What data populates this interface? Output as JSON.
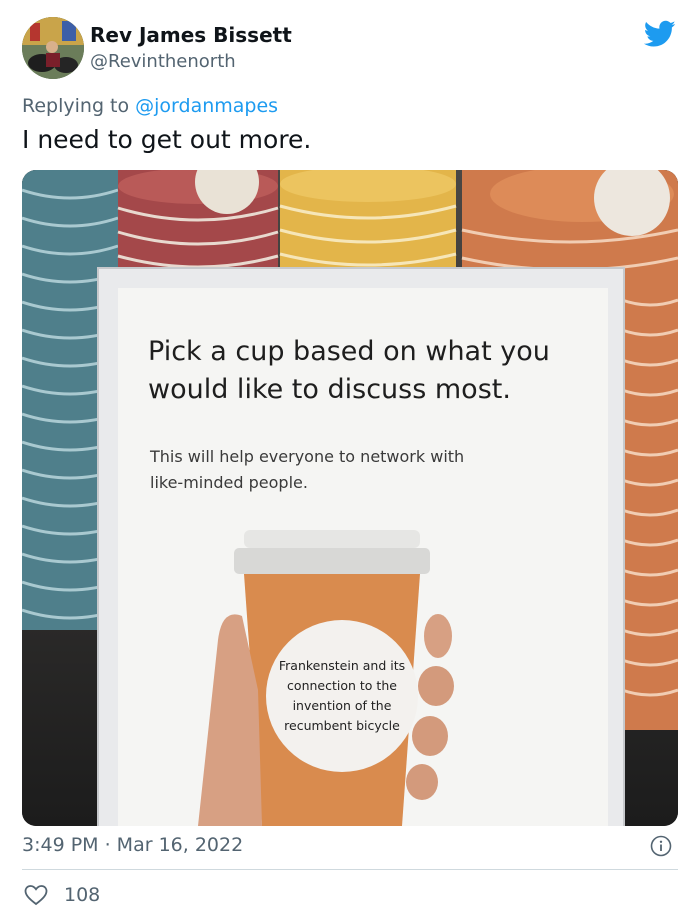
{
  "author": {
    "name": "Rev James Bissett",
    "handle": "@Revinthenorth"
  },
  "reply": {
    "prefix": "Replying to ",
    "to": "@jordanmapes"
  },
  "tweet_text": "I need to get out more.",
  "photo": {
    "sign_heading_line1": "Pick a cup based on what you",
    "sign_heading_line2": "would like to discuss most.",
    "sign_sub_line1": "This will help everyone to network with",
    "sign_sub_line2": "like-minded people.",
    "cup_label_line1": "Frankenstein and its",
    "cup_label_line2": "connection to the",
    "cup_label_line3": "invention of the",
    "cup_label_line4": "recumbent bicycle"
  },
  "timestamp": "3:49 PM · Mar 16, 2022",
  "likes": "108",
  "colors": {
    "brand": "#1d9bf0",
    "cup_orange": "#d98b4e",
    "secondary_text": "#536471"
  },
  "icons": [
    "twitter-bird-icon",
    "info-icon",
    "heart-icon"
  ]
}
